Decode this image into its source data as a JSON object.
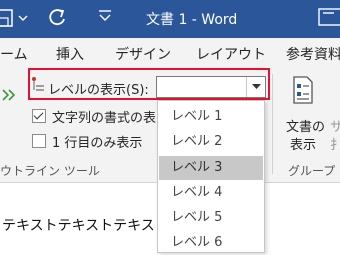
{
  "window": {
    "title": "文書 1 - Word"
  },
  "menu": {
    "tabs": [
      "ーム",
      "挿入",
      "デザイン",
      "レイアウト",
      "参考資料"
    ]
  },
  "ribbon": {
    "level_label": "レベルの表示(S):",
    "level_value": "",
    "show_text_format_label": "文字列の書式の表",
    "show_text_format_checked": true,
    "show_first_line_label": "1 行目のみ表示",
    "show_first_line_checked": false,
    "group_outline_tools": "ウトライン ツール",
    "show_document_label_1": "文書の",
    "show_document_label_2": "表示",
    "sub_doc_fragment_1": "サ",
    "sub_doc_fragment_2": "扌",
    "group_master_document": "グループ"
  },
  "level_dropdown": {
    "items": [
      "レベル 1",
      "レベル 2",
      "レベル 3",
      "レベル 4",
      "レベル 5",
      "レベル 6"
    ],
    "highlighted_index": 2
  },
  "document": {
    "body_text": "テキストテキストテキスト"
  },
  "colors": {
    "title_bar": "#2b579a",
    "highlight_box": "#e8112d",
    "promote_arrows": "#3a9a3a"
  }
}
